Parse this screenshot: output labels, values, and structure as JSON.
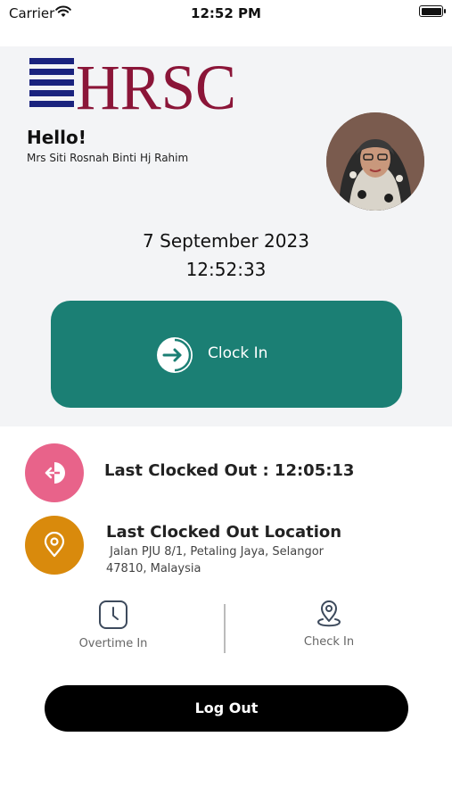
{
  "status_bar": {
    "carrier": "Carrier",
    "time": "12:52 PM"
  },
  "logo": {
    "text": "HRSC",
    "colors": {
      "stripes": "#1a237e",
      "letters": "#8b1538"
    }
  },
  "greeting": {
    "hello": "Hello!",
    "name": "Mrs Siti Rosnah Binti Hj Rahim"
  },
  "datetime": {
    "date": "7 September 2023",
    "time": "12:52:33"
  },
  "clock_in": {
    "label": "Clock In",
    "color": "#1b7f74"
  },
  "last_clocked_out": {
    "label": "Last Clocked Out : 12:05:13",
    "icon": "clock-out-icon",
    "color": "#e8638a"
  },
  "last_location": {
    "title": "Last Clocked Out Location",
    "address_line1": " Jalan PJU 8/1, Petaling Jaya, Selangor",
    "address_line2": "47810, Malaysia",
    "icon": "location-pin-icon",
    "color": "#d98a0c"
  },
  "quick_actions": [
    {
      "label": "Overtime In",
      "icon": "clock-icon"
    },
    {
      "label": "Check In",
      "icon": "map-pin-icon"
    }
  ],
  "logout": {
    "label": "Log Out"
  }
}
